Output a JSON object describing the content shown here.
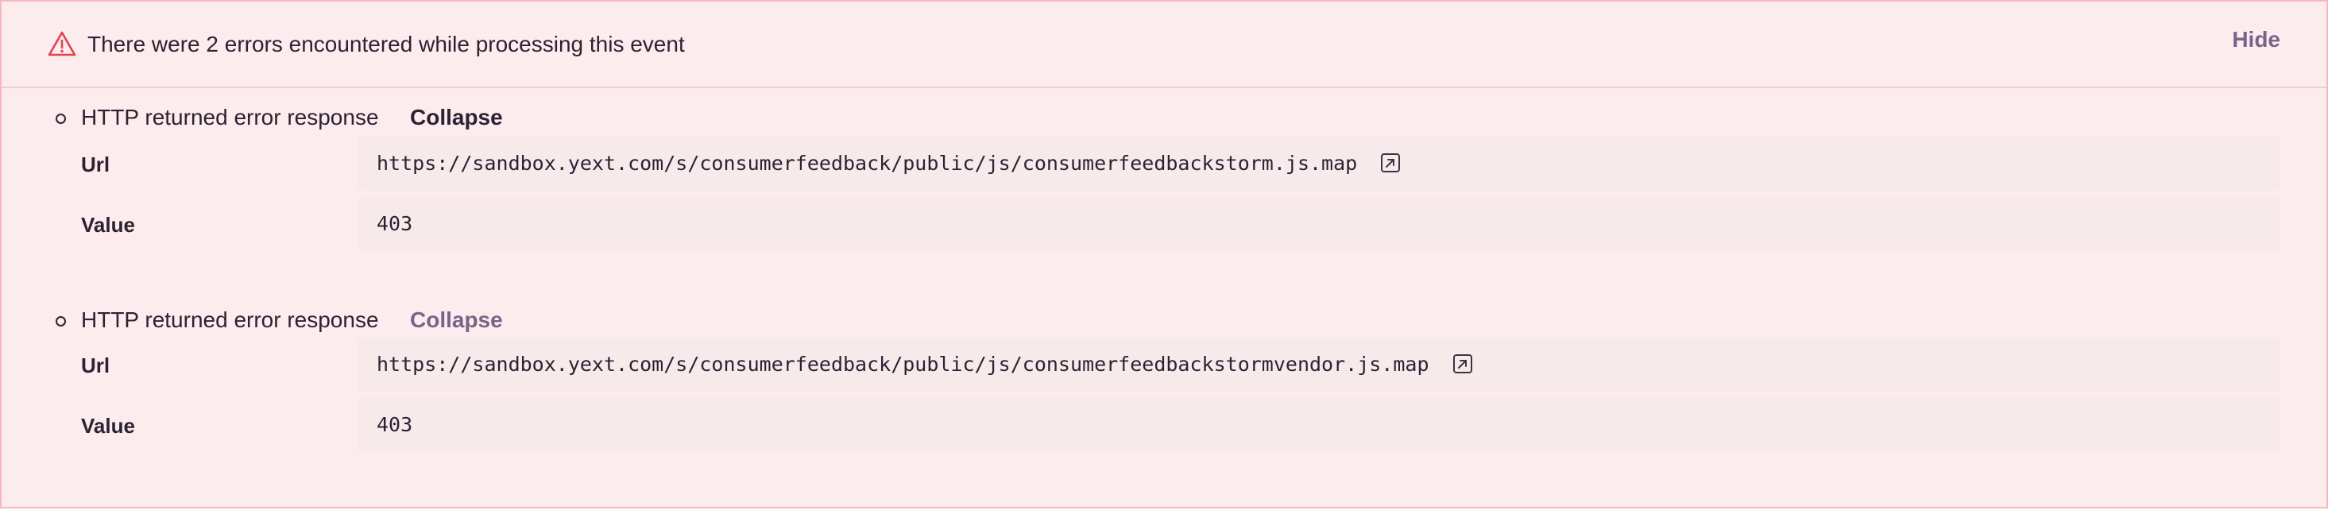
{
  "alert": {
    "title": "There were 2 errors encountered while processing this event",
    "hide_label": "Hide",
    "icon": "warning-triangle-icon",
    "colors": {
      "background": "#fdeced",
      "border": "#f5b8bd",
      "icon": "#e0434f",
      "muted_action": "#776589"
    }
  },
  "errors": [
    {
      "title": "HTTP returned error response",
      "collapse_label": "Collapse",
      "fields": [
        {
          "key": "Url",
          "value": "https://sandbox.yext.com/s/consumerfeedback/public/js/consumerfeedbackstorm.js.map",
          "icon": "open-external-icon"
        },
        {
          "key": "Value",
          "value": "403"
        }
      ]
    },
    {
      "title": "HTTP returned error response",
      "collapse_label": "Collapse",
      "fields": [
        {
          "key": "Url",
          "value": "https://sandbox.yext.com/s/consumerfeedback/public/js/consumerfeedbackstormvendor.js.map",
          "icon": "open-external-icon"
        },
        {
          "key": "Value",
          "value": "403"
        }
      ]
    }
  ]
}
